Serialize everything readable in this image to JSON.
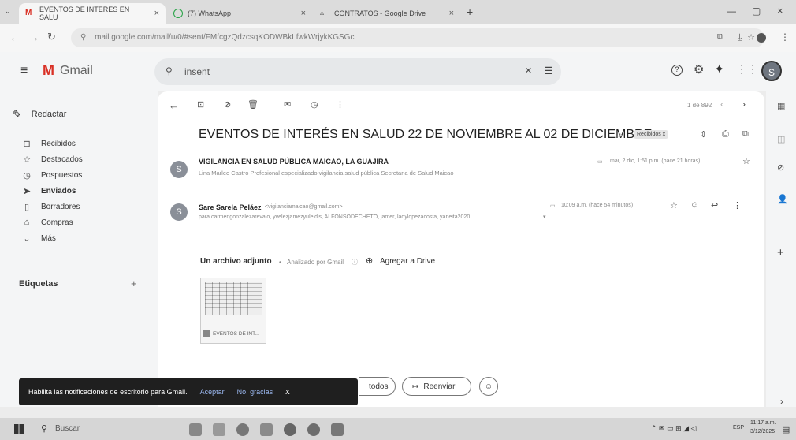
{
  "browser": {
    "tabs": [
      {
        "title": "EVENTOS DE INTERES EN SALU",
        "active": true
      },
      {
        "title": "(7) WhatsApp",
        "active": false
      },
      {
        "title": "CONTRATOS - Google Drive",
        "active": false
      }
    ],
    "new_tab": "+",
    "url": "mail.google.com/mail/u/0/#sent/FMfcgzQdzcsqKODWBkLfwkWrjykKGSGc"
  },
  "gmail": {
    "logo": "Gmail",
    "search_value": "insent",
    "compose": "Redactar",
    "nav": [
      {
        "label": "Recibidos",
        "icon": "inbox-icon"
      },
      {
        "label": "Destacados",
        "icon": "star-icon"
      },
      {
        "label": "Pospuestos",
        "icon": "clock-icon"
      },
      {
        "label": "Enviados",
        "icon": "send-icon"
      },
      {
        "label": "Borradores",
        "icon": "draft-icon"
      },
      {
        "label": "Compras",
        "icon": "tag-icon"
      },
      {
        "label": "Más",
        "icon": "chevron-down-icon"
      }
    ],
    "labels_title": "Etiquetas",
    "labels_add": "+"
  },
  "thread": {
    "pagination": "1 de 892",
    "subject": "EVENTOS DE INTERÉS EN SALUD 22 DE NOVIEMBRE AL 02 DE DICIEMBRE",
    "label_chip": "Recibidos x",
    "messages": [
      {
        "avatar": "S",
        "sender": "VIGILANCIA EN SALUD PÚBLICA MAICAO, LA GUAJIRA",
        "snippet": "Lina Marleo Castro Profesional especializado vigilancia salud pública Secretaria de Salud Maicao",
        "date": "mar, 2 dic, 1:51 p.m. (hace 21 horas)"
      },
      {
        "avatar": "S",
        "sender": "Sare Sarela Peláez",
        "sender_email": "<vigilanciamaicao@gmail.com>",
        "to": "para carmengonzalezarevalo, yvelezjamezyuleidis, ALFONSODECHETO, jamer, ladylopezacosta, yaneita2020",
        "date": "10:09 a.m. (hace 54 minutos)",
        "more": "..."
      }
    ],
    "attachment_header": "Un archivo adjunto",
    "scanned": "Analizado por Gmail",
    "add_to_drive": "Agregar a Drive",
    "attachment_name": "EVENTOS DE INT...",
    "reply_all": "todos",
    "forward": "Reenviar"
  },
  "snackbar": {
    "text": "Habilita las notificaciones de escritorio para Gmail.",
    "accept": "Aceptar",
    "decline": "No, gracias",
    "close": "x"
  },
  "taskbar": {
    "search_placeholder": "Buscar",
    "language": "ESP",
    "time": "11:17 a.m.",
    "date": "3/12/2025"
  },
  "colors": {
    "gmail_red": "#d93025",
    "avatar_gray": "#8a8f98",
    "snackbar_bg": "#1f1f1f"
  }
}
